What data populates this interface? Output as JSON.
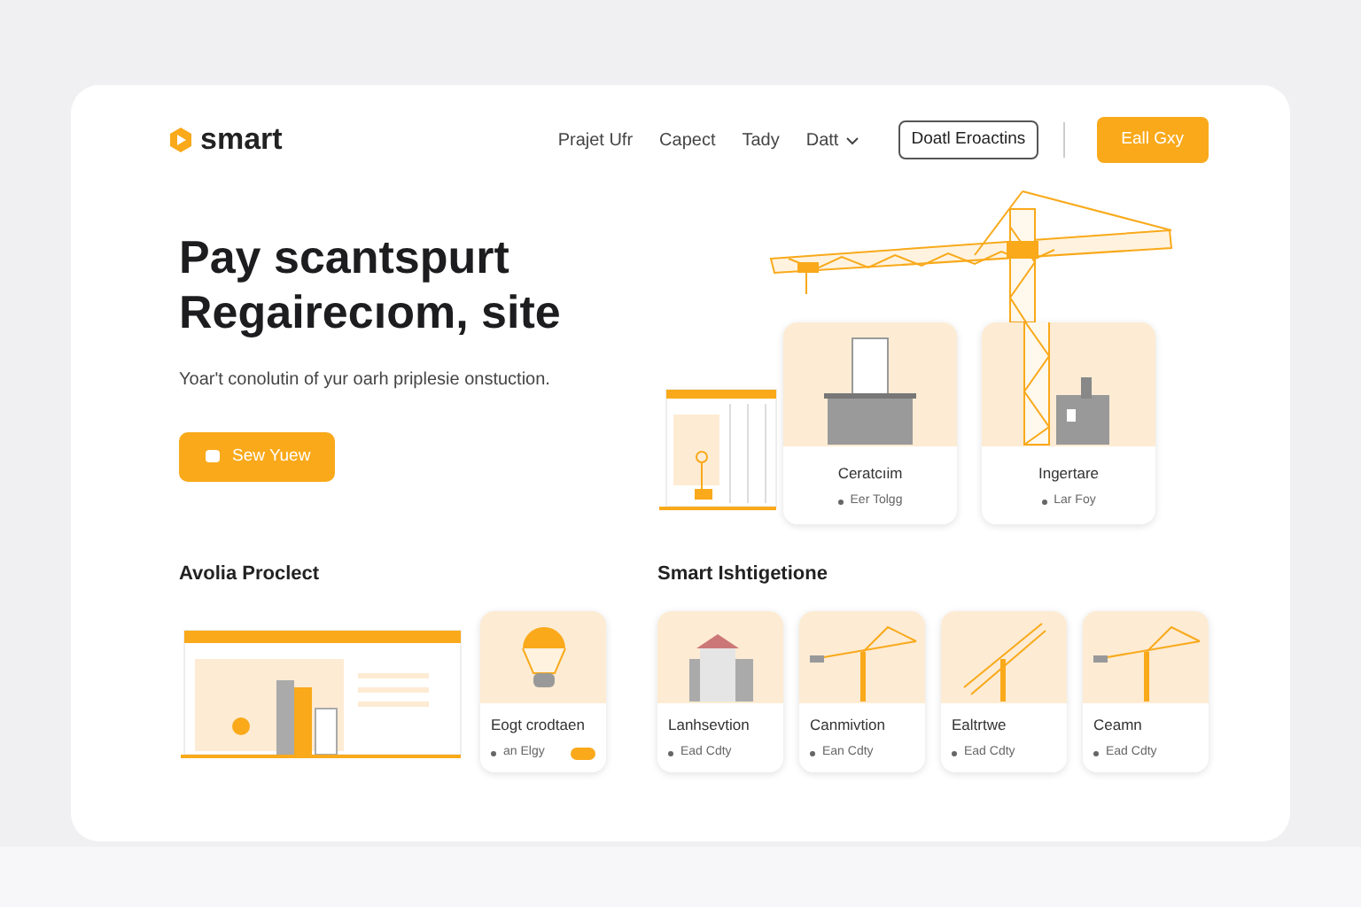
{
  "brand": {
    "name": "smart"
  },
  "nav": [
    {
      "label": "Prajet Ufr",
      "kind": "link"
    },
    {
      "label": "Capect",
      "kind": "link"
    },
    {
      "label": "Tady",
      "kind": "link"
    },
    {
      "label": "Datt",
      "kind": "dropdown"
    }
  ],
  "actions": [
    {
      "label": "Doatl Eroactins",
      "kind": "outline"
    },
    {
      "label": "Eall Gxy",
      "kind": "primary"
    }
  ],
  "hero": {
    "title": "Pay scantspurt Regairecıom, site",
    "subtitle": "Yoar't conolutin of yur oarh priplesie onstuction.",
    "button": "Sew Yuew",
    "cards": [
      {
        "title": "Ceratcıim",
        "meta": "Eer Tolgg",
        "kind": "desk"
      },
      {
        "title": "Ingertare",
        "meta": "Lar Foy",
        "kind": "building"
      }
    ]
  },
  "projects": {
    "title": "Avolia Proclect",
    "cards": [
      {
        "title": "Eogt crodtaen",
        "meta": "an Elgy",
        "kind": "bulb",
        "tag": true
      }
    ]
  },
  "insights": {
    "title": "Smart Ishtigetione",
    "cards": [
      {
        "title": "Lanhsevtion",
        "meta": "Ead Cdty",
        "kind": "house"
      },
      {
        "title": "Canmivtion",
        "meta": "Ean Cdty",
        "kind": "crane"
      },
      {
        "title": "Ealtrtwe",
        "meta": "Ead Cdty",
        "kind": "crane-tilt"
      },
      {
        "title": "Ceamn",
        "meta": "Ead Cdty",
        "kind": "crane"
      }
    ]
  }
}
